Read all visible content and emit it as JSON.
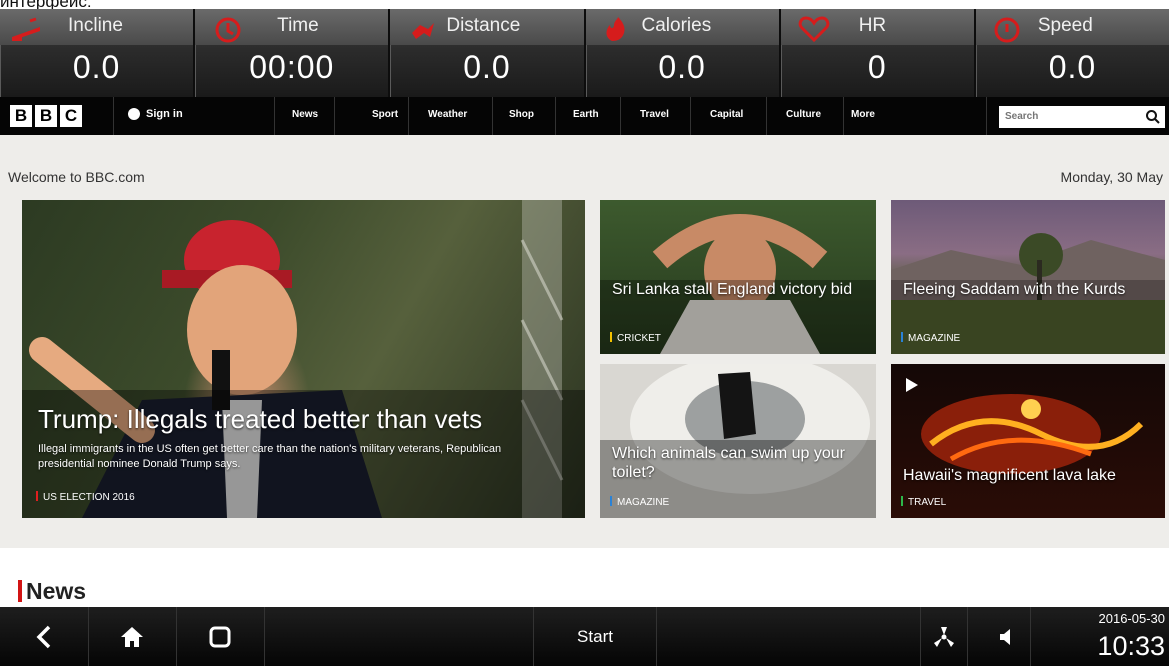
{
  "top_clipped_text": "интерфейс:",
  "stats": [
    {
      "label": "Incline",
      "value": "0.0",
      "icon": "incline-icon"
    },
    {
      "label": "Time",
      "value": "00:00",
      "icon": "clock-icon"
    },
    {
      "label": "Distance",
      "value": "0.0",
      "icon": "runner-icon"
    },
    {
      "label": "Calories",
      "value": "0.0",
      "icon": "flame-icon"
    },
    {
      "label": "HR",
      "value": "0",
      "icon": "heart-icon"
    },
    {
      "label": "Speed",
      "value": "0.0",
      "icon": "speedometer-icon"
    }
  ],
  "browser": {
    "url_fragment": "www.bbc"
  },
  "bbc": {
    "logo_letters": [
      "B",
      "B",
      "C"
    ],
    "sign_in": "Sign in",
    "nav": [
      "News",
      "Sport",
      "Weather",
      "Shop",
      "Earth",
      "Travel",
      "Capital",
      "Culture",
      "More"
    ],
    "search_placeholder": "Search",
    "welcome": "Welcome to BBC.com",
    "date": "Monday, 30 May",
    "hero": {
      "title": "Trump: Illegals treated better than vets",
      "summary": "Illegal immigrants in the US often get better care than the nation's military veterans, Republican presidential nominee Donald Trump says.",
      "tag": "US ELECTION 2016",
      "tag_color": "#e01f1f"
    },
    "cards": [
      {
        "title": "Sri Lanka stall England victory bid",
        "tag": "CRICKET",
        "tag_color": "#f2c100"
      },
      {
        "title": "Fleeing Saddam with the Kurds",
        "tag": "MAGAZINE",
        "tag_color": "#2a82d6"
      },
      {
        "title": "Which animals can swim up your toilet?",
        "tag": "MAGAZINE",
        "tag_color": "#2a82d6"
      },
      {
        "title": "Hawaii's magnificent lava lake",
        "tag": "TRAVEL",
        "tag_color": "#2db74a"
      }
    ],
    "section_heading": "News"
  },
  "taskbar": {
    "start": "Start",
    "date": "2016-05-30",
    "time": "10:33"
  }
}
